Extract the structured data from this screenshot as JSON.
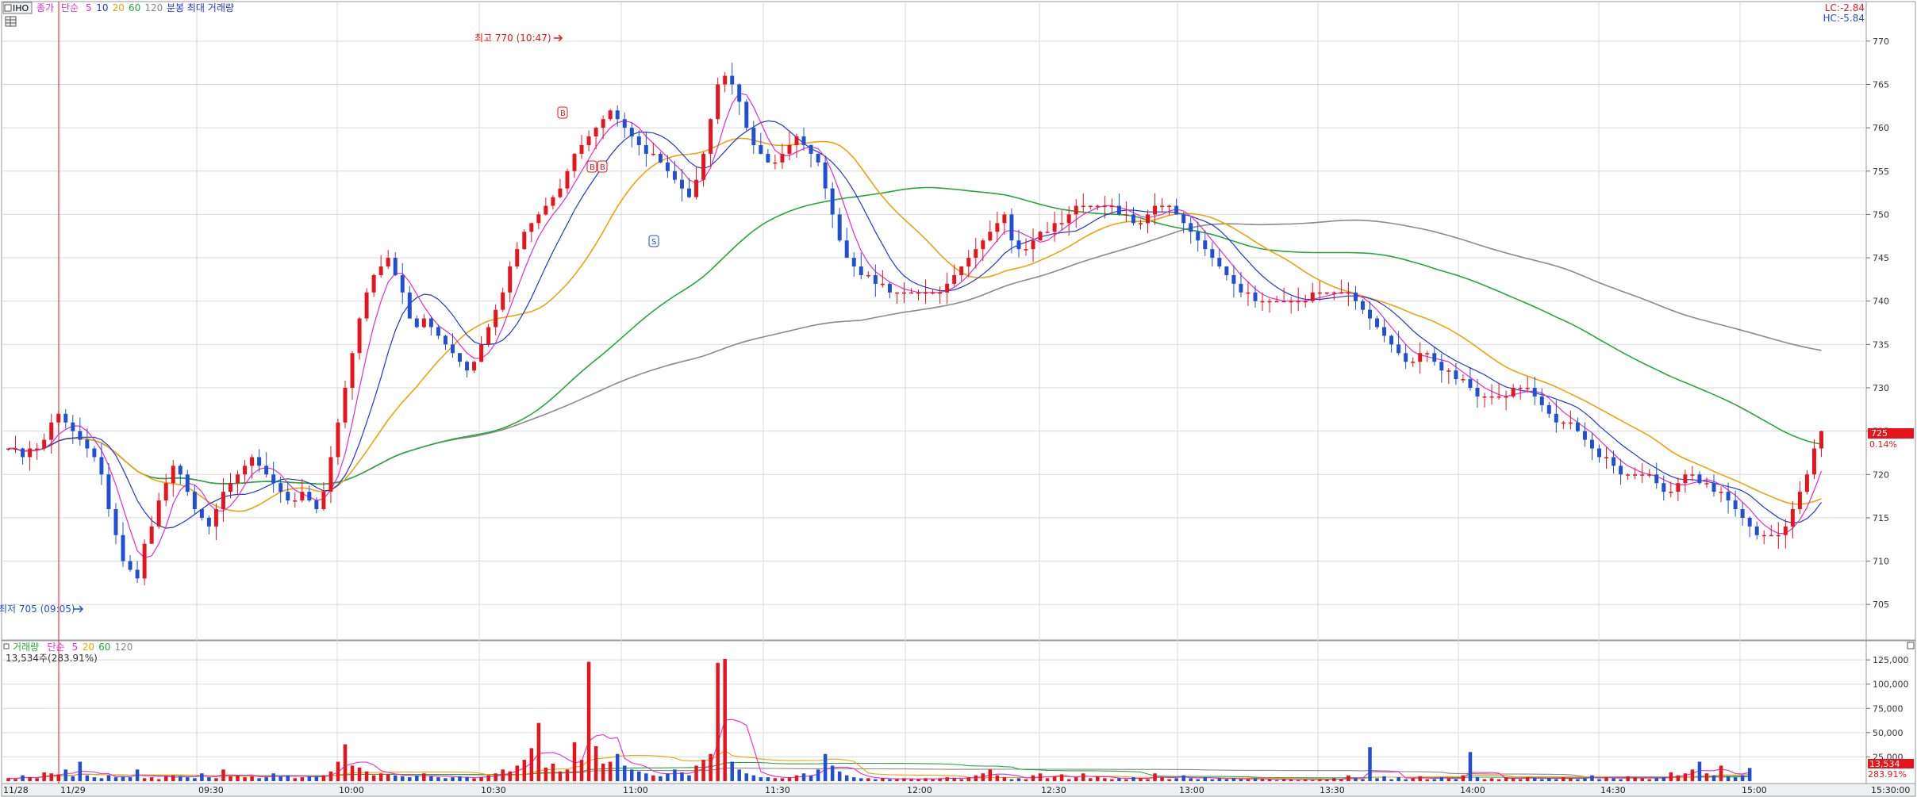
{
  "colors": {
    "up": "#e8141b",
    "down": "#1f4fd6",
    "ma5": "#e42bd0",
    "ma10": "#2036d8",
    "ma20": "#f0a20c",
    "ma60": "#25a83c",
    "ma120": "#8a8a8a",
    "grid": "#d9d9d9",
    "axis_text": "#333333",
    "current_bg": "#e8141b"
  },
  "price_legend": {
    "symbol": "IHO",
    "items": [
      {
        "text": "종가",
        "color": "#e42bd0"
      },
      {
        "text": "단순",
        "color": "#e42bd0"
      },
      {
        "text": "5",
        "color": "#e42bd0"
      },
      {
        "text": "10",
        "color": "#2036d8"
      },
      {
        "text": "20",
        "color": "#f0a20c"
      },
      {
        "text": "60",
        "color": "#25a83c"
      },
      {
        "text": "120",
        "color": "#8a8a8a"
      },
      {
        "text": "분봉 최대 거래량",
        "color": "#2036d8"
      }
    ]
  },
  "volume_legend": {
    "items": [
      {
        "text": "거래량",
        "color": "#25a83c"
      },
      {
        "text": "단순",
        "color": "#e42bd0"
      },
      {
        "text": "5",
        "color": "#e42bd0"
      },
      {
        "text": "20",
        "color": "#f0a20c"
      },
      {
        "text": "60",
        "color": "#25a83c"
      },
      {
        "text": "120",
        "color": "#8a8a8a"
      }
    ],
    "summary": "13,534주(283.91%)"
  },
  "limits": {
    "lc": "LC:-2.84",
    "hc": "HC:-5.84"
  },
  "annotations": {
    "high": "최고 770 (10:47)",
    "low": "최저 705 (09:05)",
    "current_price": "725",
    "current_change": "0.14%",
    "current_volume": "13,534",
    "current_volume_pct": "283.91%",
    "signal_b": "B",
    "signal_s": "S"
  },
  "x_axis": {
    "labels": [
      "11/28",
      "11/29",
      "09:30",
      "10:00",
      "10:30",
      "11:00",
      "11:30",
      "12:00",
      "12:30",
      "13:00",
      "13:30",
      "14:00",
      "14:30",
      "15:00",
      "15:30:00"
    ]
  },
  "chart_data": [
    {
      "type": "candlestick",
      "ylim": [
        702,
        772
      ],
      "y_ticks": [
        "705",
        "710",
        "715",
        "720",
        "725",
        "730",
        "735",
        "740",
        "745",
        "750",
        "755",
        "760",
        "765",
        "770"
      ],
      "moving_averages": [
        "5",
        "10",
        "20",
        "60",
        "120"
      ],
      "high": {
        "price": 770,
        "time": "10:47"
      },
      "low": {
        "price": 705,
        "time": "09:05"
      },
      "last": 725,
      "close_series": [
        723,
        723,
        722,
        723,
        723,
        724,
        726,
        727,
        726,
        725,
        724,
        723,
        722,
        720,
        716,
        713,
        710,
        709,
        708,
        712,
        714,
        717,
        719,
        721,
        720,
        718,
        716,
        715,
        714,
        716,
        718,
        719,
        720,
        721,
        722,
        721,
        720,
        719,
        718,
        717,
        717,
        718,
        717,
        716,
        718,
        722,
        726,
        730,
        734,
        738,
        741,
        743,
        744,
        745,
        743,
        741,
        738,
        737,
        738,
        737,
        736,
        735,
        734,
        733,
        732,
        733,
        735,
        737,
        739,
        741,
        744,
        746,
        748,
        749,
        750,
        751,
        752,
        753,
        755,
        757,
        758,
        759,
        760,
        761,
        762,
        761,
        760,
        759,
        758,
        757,
        757,
        756,
        755,
        754,
        753,
        752,
        754,
        757,
        761,
        765,
        766,
        765,
        763,
        760,
        758,
        757,
        756,
        756,
        757,
        758,
        759,
        758,
        757,
        756,
        753,
        750,
        747,
        745,
        744,
        743,
        743,
        742,
        742,
        741,
        741,
        741,
        741,
        741,
        741,
        741,
        741,
        742,
        743,
        744,
        745,
        746,
        747,
        748,
        749,
        750,
        747,
        746,
        746,
        747,
        748,
        748,
        749,
        749,
        750,
        751,
        751,
        751,
        751,
        751,
        751,
        750,
        750,
        749,
        749,
        750,
        751,
        751,
        751,
        750,
        749,
        748,
        747,
        746,
        745,
        744,
        743,
        742,
        741,
        741,
        740,
        740,
        740,
        740,
        740,
        740,
        740,
        740,
        741,
        741,
        741,
        741,
        741,
        741,
        740,
        739,
        738,
        737,
        736,
        735,
        734,
        733,
        733,
        734,
        734,
        733,
        732,
        732,
        731,
        731,
        730,
        729,
        729,
        729,
        729,
        729,
        730,
        730,
        730,
        729,
        728,
        727,
        726,
        726,
        726,
        725,
        724,
        723,
        722,
        722,
        721,
        720,
        720,
        720,
        720,
        720,
        719,
        718,
        718,
        719,
        720,
        720,
        719,
        719,
        718,
        718,
        717,
        716,
        715,
        714,
        713,
        713,
        713,
        713,
        714,
        716,
        718,
        720,
        723,
        725
      ]
    },
    {
      "type": "bar",
      "title": "거래량",
      "ylim": [
        0,
        130000
      ],
      "y_ticks": [
        "25,000",
        "50,000",
        "75,000",
        "100,000",
        "125,000"
      ],
      "last": 13534,
      "last_pct": "283.91%",
      "values": [
        3000,
        2000,
        6000,
        4000,
        3000,
        9000,
        8000,
        7000,
        12000,
        5000,
        20000,
        6000,
        4000,
        3000,
        6000,
        4000,
        5000,
        4000,
        12000,
        3000,
        4000,
        2000,
        5000,
        6000,
        5000,
        4000,
        3000,
        8000,
        4000,
        3000,
        12000,
        5000,
        6000,
        4000,
        5000,
        3000,
        4000,
        8000,
        5000,
        6000,
        3000,
        4000,
        5000,
        5000,
        6000,
        10000,
        20000,
        38000,
        16000,
        14000,
        10000,
        6000,
        8000,
        7000,
        6000,
        5000,
        4000,
        6000,
        8000,
        5000,
        4000,
        3000,
        4000,
        5000,
        4000,
        3000,
        4000,
        6000,
        8000,
        12000,
        10000,
        16000,
        22000,
        34000,
        60000,
        14000,
        18000,
        10000,
        12000,
        40000,
        22000,
        123000,
        36000,
        18000,
        20000,
        28000,
        16000,
        12000,
        10000,
        8000,
        6000,
        5000,
        8000,
        12000,
        9000,
        6000,
        16000,
        22000,
        28000,
        122000,
        126000,
        20000,
        12000,
        8000,
        6000,
        4000,
        4000,
        3000,
        3000,
        4000,
        6000,
        8000,
        6000,
        12000,
        28000,
        16000,
        10000,
        6000,
        4000,
        3000,
        3000,
        2000,
        3000,
        2000,
        2000,
        3000,
        2000,
        2000,
        3000,
        2000,
        3000,
        4000,
        3000,
        2000,
        4000,
        6000,
        8000,
        12000,
        6000,
        4000,
        2000,
        3000,
        2000,
        6000,
        8000,
        3000,
        5000,
        7000,
        2000,
        4000,
        8000,
        3000,
        5000,
        3000,
        2000,
        3000,
        2000,
        4000,
        3000,
        2000,
        8000,
        4000,
        2000,
        3000,
        6000,
        3000,
        2000,
        4000,
        2000,
        3000,
        2000,
        3000,
        2000,
        2000,
        3000,
        2000,
        2000,
        1000,
        2000,
        2000,
        1000,
        2000,
        1000,
        2000,
        2000,
        3000,
        2000,
        6000,
        3000,
        2000,
        35000,
        3000,
        5000,
        2000,
        4000,
        2000,
        3000,
        5000,
        2000,
        2000,
        4000,
        3000,
        2000,
        6000,
        30000,
        4000,
        2000,
        3000,
        2000,
        4000,
        3000,
        2000,
        4000,
        3000,
        2000,
        3000,
        2000,
        4000,
        3000,
        2000,
        3000,
        6000,
        2000,
        4000,
        3000,
        2000,
        5000,
        4000,
        3000,
        2000,
        3000,
        4000,
        9000,
        6000,
        8000,
        12000,
        20000,
        8000,
        6000,
        16000,
        5000,
        4000,
        6000,
        13534
      ]
    }
  ]
}
